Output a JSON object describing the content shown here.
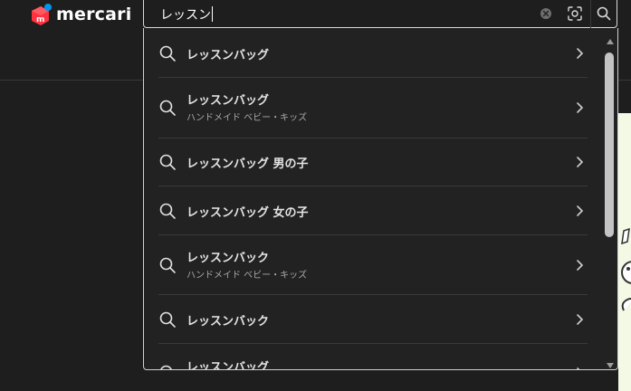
{
  "brand": {
    "name": "mercari"
  },
  "search": {
    "query": "レッスン"
  },
  "suggestions": [
    {
      "title": "レッスンバッグ",
      "category": ""
    },
    {
      "title": "レッスンバッグ",
      "category": "ハンドメイド ベビー・キッズ"
    },
    {
      "title": "レッスンバッグ 男の子",
      "category": ""
    },
    {
      "title": "レッスンバッグ 女の子",
      "category": ""
    },
    {
      "title": "レッスンバック",
      "category": "ハンドメイド ベビー・キッズ"
    },
    {
      "title": "レッスンバック",
      "category": ""
    },
    {
      "title": "レッスンバッグ",
      "category": ""
    }
  ],
  "icons": {
    "logo": "mercari-logo-icon",
    "clear": "clear-icon",
    "camera": "camera-scan-icon",
    "search": "search-icon",
    "suggestion": "search-icon",
    "arrow": "chevron-right-icon"
  },
  "colors": {
    "brand_red": "#ff333f",
    "brand_blue": "#0095ee",
    "background": "#1e1e1e",
    "dropdown": "#222222"
  }
}
